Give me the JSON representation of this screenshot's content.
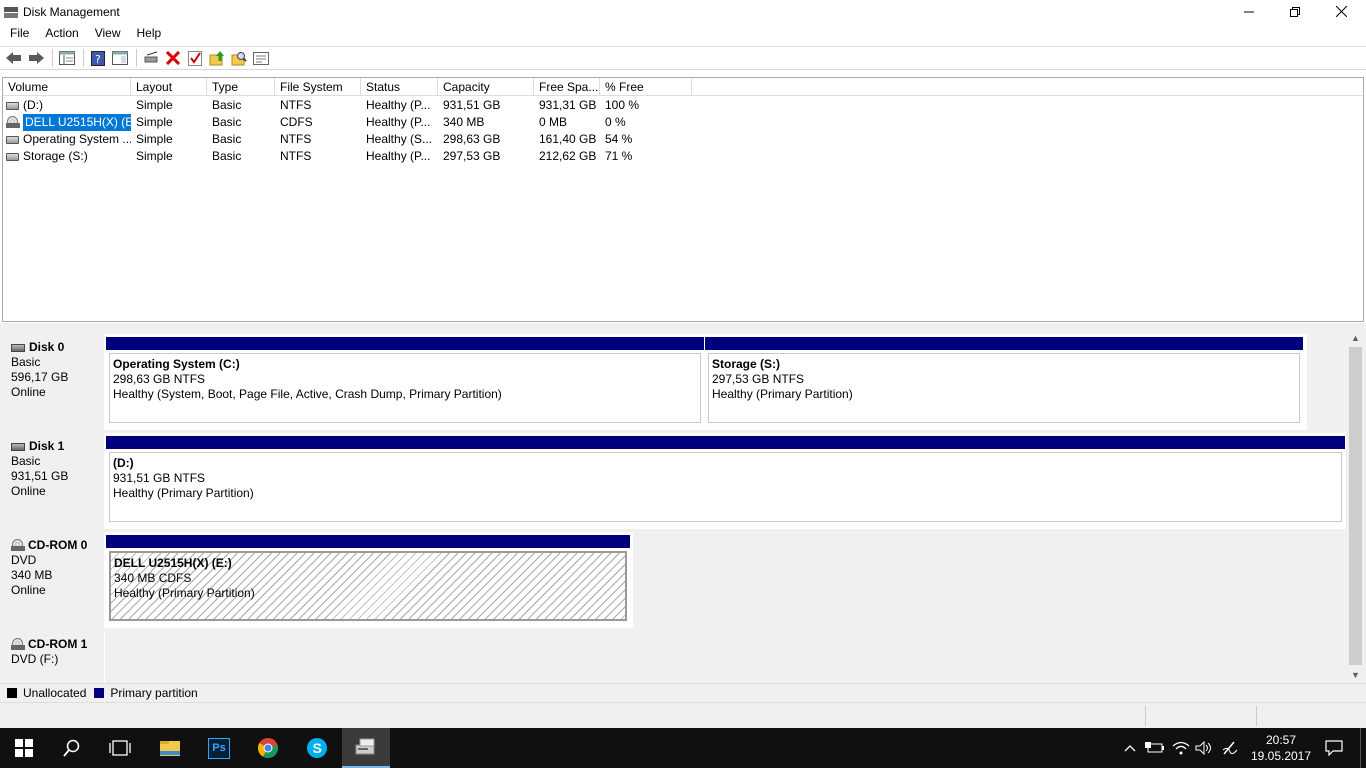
{
  "window": {
    "title": "Disk Management"
  },
  "menu": [
    "File",
    "Action",
    "View",
    "Help"
  ],
  "volume_list": {
    "columns": [
      "Volume",
      "Layout",
      "Type",
      "File System",
      "Status",
      "Capacity",
      "Free Spa...",
      "% Free"
    ],
    "rows": [
      {
        "icon": "drive-icon",
        "cells": [
          " (D:)",
          "Simple",
          "Basic",
          "NTFS",
          "Healthy (P...",
          "931,51 GB",
          "931,31 GB",
          "100 %"
        ]
      },
      {
        "icon": "cdrom-icon",
        "selected": true,
        "cells": [
          "DELL U2515H(X) (E:)",
          "Simple",
          "Basic",
          "CDFS",
          "Healthy (P...",
          "340 MB",
          "0 MB",
          "0 %"
        ]
      },
      {
        "icon": "drive-icon",
        "cells": [
          "Operating System ...",
          "Simple",
          "Basic",
          "NTFS",
          "Healthy (S...",
          "298,63 GB",
          "161,40 GB",
          "54 %"
        ]
      },
      {
        "icon": "drive-icon",
        "cells": [
          "Storage (S:)",
          "Simple",
          "Basic",
          "NTFS",
          "Healthy (P...",
          "297,53 GB",
          "212,62 GB",
          "71 %"
        ]
      }
    ]
  },
  "disks": [
    {
      "name": "Disk 0",
      "type": "Basic",
      "size": "596,17 GB",
      "state": "Online",
      "partitions": [
        {
          "name": "Operating System  (C:)",
          "size_fs": "298,63 GB NTFS",
          "status": "Healthy (System, Boot, Page File, Active, Crash Dump, Primary Partition)"
        },
        {
          "name": "Storage  (S:)",
          "size_fs": "297,53 GB NTFS",
          "status": "Healthy (Primary Partition)"
        }
      ]
    },
    {
      "name": "Disk 1",
      "type": "Basic",
      "size": "931,51 GB",
      "state": "Online",
      "partitions": [
        {
          "name": " (D:)",
          "size_fs": "931,51 GB NTFS",
          "status": "Healthy (Primary Partition)"
        }
      ]
    },
    {
      "name": "CD-ROM 0",
      "type": "DVD",
      "size": "340 MB",
      "state": "Online",
      "partitions": [
        {
          "name": "DELL U2515H(X)  (E:)",
          "size_fs": "340 MB CDFS",
          "status": "Healthy (Primary Partition)"
        }
      ]
    },
    {
      "name": "CD-ROM 1",
      "type": "DVD (F:)"
    }
  ],
  "legend": {
    "unallocated": "Unallocated",
    "primary": "Primary partition",
    "unallocated_color": "#000000",
    "primary_color": "#00007f"
  },
  "taskbar": {
    "time": "20:57",
    "date": "19.05.2017",
    "ps_label": "Ps"
  }
}
